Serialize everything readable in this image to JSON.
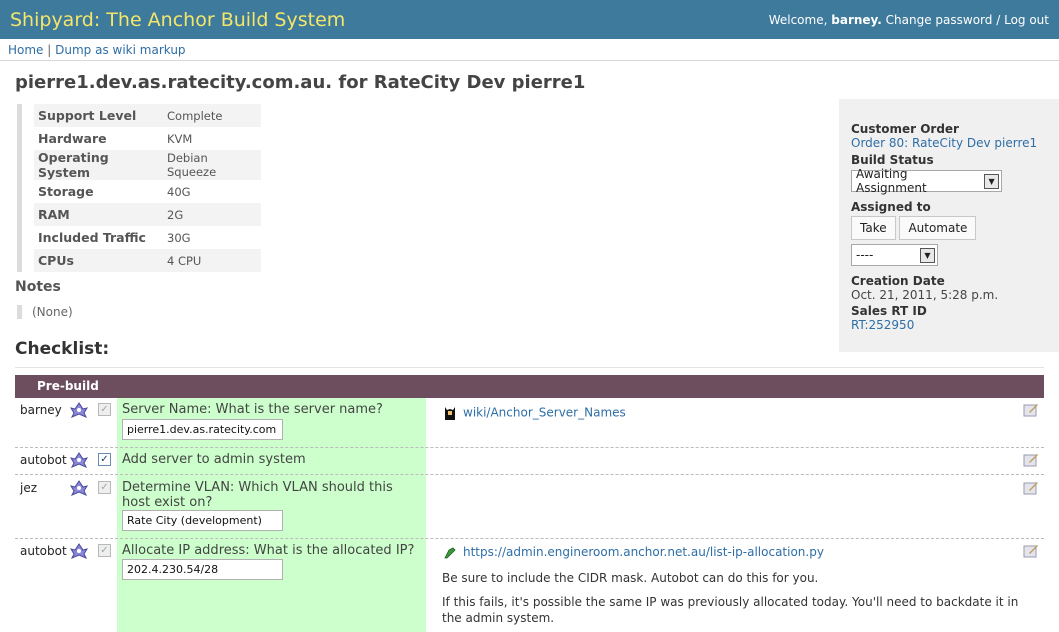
{
  "header": {
    "app_title": "Shipyard: The Anchor Build System",
    "welcome": "Welcome,",
    "username": "barney.",
    "change_password": "Change password",
    "separator": "/",
    "logout": "Log out"
  },
  "subnav": {
    "home": "Home",
    "sep": "|",
    "dump": "Dump as wiki markup"
  },
  "page_title": "pierre1.dev.as.ratecity.com.au. for RateCity Dev pierre1",
  "specs": [
    {
      "label": "Support Level",
      "value": "Complete"
    },
    {
      "label": "Hardware",
      "value": "KVM"
    },
    {
      "label": "Operating System",
      "value": "Debian Squeeze"
    },
    {
      "label": "Storage",
      "value": "40G"
    },
    {
      "label": "RAM",
      "value": "2G"
    },
    {
      "label": "Included Traffic",
      "value": "30G"
    },
    {
      "label": "CPUs",
      "value": "4 CPU"
    }
  ],
  "notes": {
    "heading": "Notes",
    "value": "(None)"
  },
  "checklist": {
    "heading": "Checklist:",
    "section": "Pre-build"
  },
  "panel": {
    "customer_order_label": "Customer Order",
    "customer_order_link": "Order 80: RateCity Dev pierre1",
    "build_status_label": "Build Status",
    "build_status_value": "Awaiting Assignment",
    "assigned_label": "Assigned to",
    "take_button": "Take",
    "automate_button": "Automate",
    "assignee_value": "----",
    "creation_label": "Creation Date",
    "creation_value": "Oct. 21, 2011, 5:28 p.m.",
    "sales_label": "Sales RT ID",
    "sales_link": "RT:252950"
  },
  "rows": [
    {
      "who": "barney",
      "checked": false,
      "task": "Server Name: What is the server name?",
      "input": "pierre1.dev.as.ratecity.com",
      "link": "wiki/Anchor_Server_Names"
    },
    {
      "who": "autobot",
      "checked": true,
      "task": "Add server to admin system"
    },
    {
      "who": "jez",
      "checked": false,
      "task": "Determine VLAN: Which VLAN should this host exist on?",
      "input": "Rate City (development)"
    },
    {
      "who": "autobot",
      "checked": false,
      "task": "Allocate IP address: What is the allocated IP?",
      "input": "202.4.230.54/28",
      "link": "https://admin.engineroom.anchor.net.au/list-ip-allocation.py",
      "note1": "Be sure to include the CIDR mask. Autobot can do this for you.",
      "note2": "If this fails, it's possible the same IP was previously allocated today. You'll need to backdate it in the admin system."
    }
  ],
  "colors": {
    "header_bg": "#3d7a9c",
    "title_yellow": "#f4e66a",
    "section_bar": "#6d4e5f",
    "task_green": "#ccffcc",
    "link_blue": "#2e6ea6"
  },
  "icons": [
    "user-peep-icon",
    "edit-note-icon",
    "wiki-batman-icon",
    "admin-link-icon",
    "chevron-down-icon"
  ]
}
